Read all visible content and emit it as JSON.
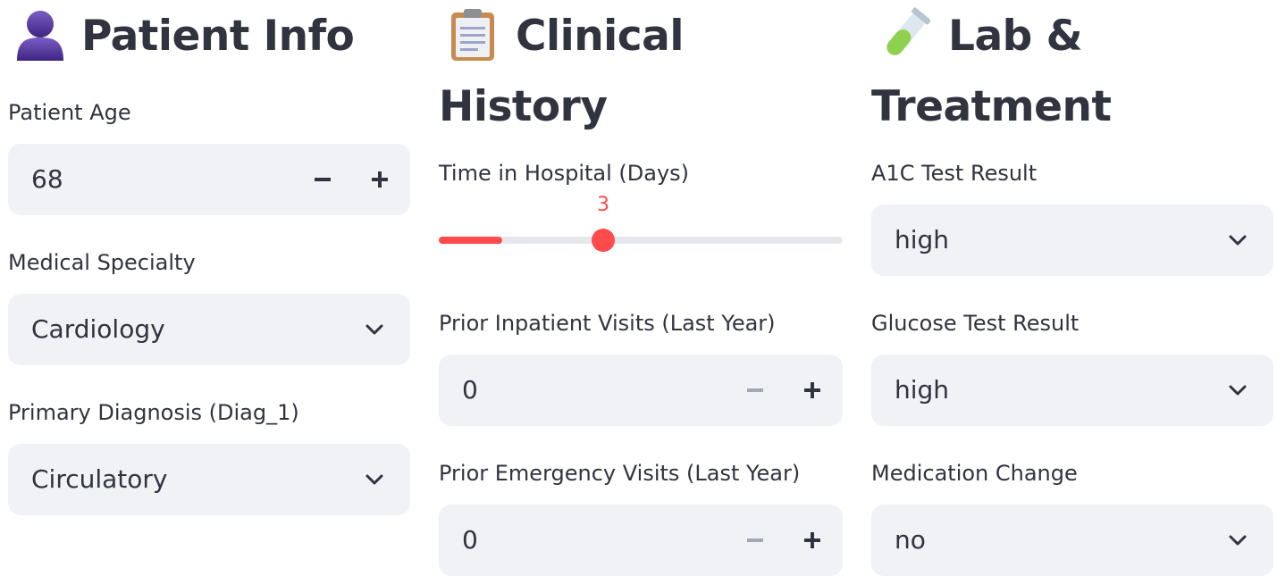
{
  "patient_info": {
    "icon": "person-silhouette-icon",
    "title": "Patient Info",
    "age": {
      "label": "Patient Age",
      "value": "68",
      "minus": "−",
      "plus": "+"
    },
    "specialty": {
      "label": "Medical Specialty",
      "value": "Cardiology"
    },
    "diagnosis": {
      "label": "Primary Diagnosis (Diag_1)",
      "value": "Circulatory"
    }
  },
  "clinical_history": {
    "icon": "clipboard-icon",
    "title_line1": "Clinical",
    "title_line2": "History",
    "time_in_hospital": {
      "label": "Time in Hospital (Days)",
      "value": "3",
      "fill_fraction": 0.16
    },
    "inpatient": {
      "label": "Prior Inpatient Visits (Last Year)",
      "value": "0"
    },
    "emergency": {
      "label": "Prior Emergency Visits (Last Year)",
      "value": "0"
    }
  },
  "lab_treatment": {
    "icon": "test-tube-icon",
    "title_line1": "Lab &",
    "title_line2": "Treatment",
    "a1c": {
      "label": "A1C Test Result",
      "value": "high"
    },
    "glucose": {
      "label": "Glucose Test Result",
      "value": "high"
    },
    "med_change": {
      "label": "Medication Change",
      "value": "no"
    }
  },
  "colors": {
    "accent": "#ff4b4b",
    "input_bg": "#f0f2f6",
    "text": "#31333f",
    "disabled": "#a3a8b4"
  }
}
